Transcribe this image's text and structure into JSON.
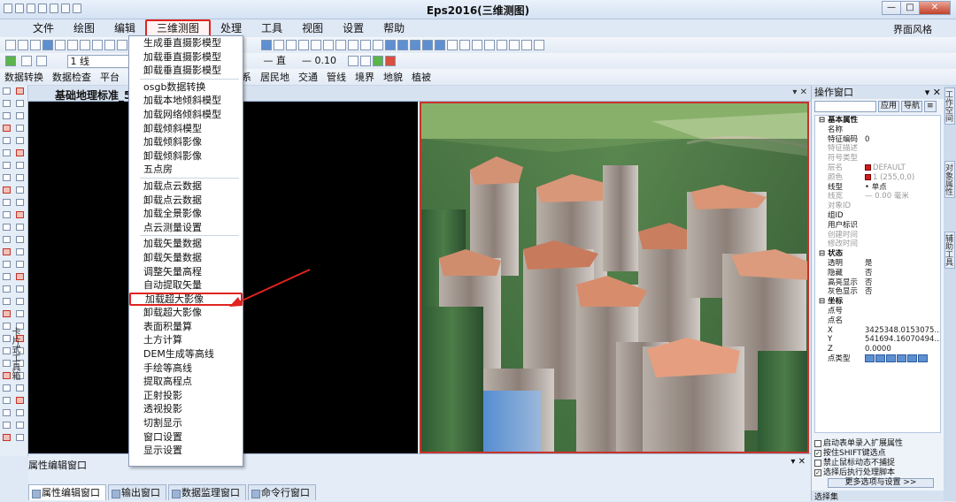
{
  "app": {
    "title": "Eps2016(三维测图)",
    "ui_style_label": "界面风格",
    "window_buttons": [
      "—",
      "□",
      "✕"
    ]
  },
  "menu": [
    {
      "label": "文件"
    },
    {
      "label": "绘图"
    },
    {
      "label": "编辑"
    },
    {
      "label": "三维测图",
      "active": true
    },
    {
      "label": "处理"
    },
    {
      "label": "工具"
    },
    {
      "label": "视图"
    },
    {
      "label": "设置"
    },
    {
      "label": "帮助"
    }
  ],
  "toolbar": {
    "layer_combo": "1 线",
    "line_width": "0.10",
    "straight_label": "直"
  },
  "categories": [
    "数据转换",
    "数据检查",
    "平台",
    "系",
    "居民地",
    "交通",
    "管线",
    "境界",
    "地貌",
    "植被"
  ],
  "dropdown": {
    "groups": [
      [
        "生成垂直摄影模型",
        "加载垂直摄影模型",
        "卸载垂直摄影模型"
      ],
      [
        "osgb数据转换",
        "加载本地倾斜模型",
        "加载网络倾斜模型",
        "卸载倾斜模型",
        "加载倾斜影像",
        "卸载倾斜影像",
        "五点房"
      ],
      [
        "加载点云数据",
        "卸载点云数据",
        "加载全景影像",
        "点云测量设置"
      ],
      [
        "加载矢量数据",
        "卸载矢量数据",
        "调整矢量高程",
        "自动提取矢量",
        "加载超大影像",
        "卸载超大影像",
        "表面积量算",
        "土方计算",
        "DEM生成等高线",
        "手绘等高线",
        "提取高程点",
        "正射投影",
        "透视投影",
        "切割显示",
        "窗口设置",
        "显示设置"
      ]
    ],
    "highlighted": "加载超大影像"
  },
  "document": {
    "tab_label": "基础地理标准_5",
    "pin": "▾ ✕"
  },
  "bottom_panel": {
    "title": "属性编辑窗口",
    "tabs": [
      {
        "label": "属性编辑窗口",
        "active": true
      },
      {
        "label": "输出窗口"
      },
      {
        "label": "数据监理窗口"
      },
      {
        "label": "命令行窗口"
      }
    ]
  },
  "left_tools_label": "卡片式工具箱",
  "right_panel": {
    "title": "操作窗口",
    "btn_apply": "应用",
    "btn_nav": "导航",
    "sections": {
      "basic": "基本属性",
      "state": "状态",
      "coords": "坐标"
    },
    "basic_rows": [
      {
        "k": "名称",
        "v": ""
      },
      {
        "k": "特征编码",
        "v": "0"
      },
      {
        "k": "特征描述",
        "v": "",
        "grey": true
      },
      {
        "k": "符号类型",
        "v": "",
        "grey": true
      },
      {
        "k": "层名",
        "v": "DEFAULT",
        "grey": true,
        "swatch": true
      },
      {
        "k": "颜色",
        "v": "1 (255,0,0)",
        "grey": true,
        "swatch": true
      },
      {
        "k": "线型",
        "v": "• 单点"
      },
      {
        "k": "线宽",
        "v": "— 0.00 毫米",
        "grey": true
      },
      {
        "k": "对象ID",
        "v": "",
        "grey": true
      },
      {
        "k": "组ID",
        "v": ""
      },
      {
        "k": "用户标识",
        "v": ""
      },
      {
        "k": "创建时间",
        "v": "",
        "grey": true
      },
      {
        "k": "修改时间",
        "v": "",
        "grey": true
      }
    ],
    "state_rows": [
      {
        "k": "透明",
        "v": "是"
      },
      {
        "k": "隐藏",
        "v": "否"
      },
      {
        "k": "高亮显示",
        "v": "否"
      },
      {
        "k": "灰色显示",
        "v": "否"
      }
    ],
    "coord_rows": [
      {
        "k": "点号",
        "v": ""
      },
      {
        "k": "点名",
        "v": ""
      },
      {
        "k": "X",
        "v": "3425348.0153075..."
      },
      {
        "k": "Y",
        "v": "541694.16070494..."
      },
      {
        "k": "Z",
        "v": "0.0000"
      },
      {
        "k": "点类型",
        "v": ""
      }
    ],
    "checks": [
      {
        "label": "启动表单录入扩展属性",
        "checked": false
      },
      {
        "label": "按住SHIFT键选点",
        "checked": true
      },
      {
        "label": "禁止鼠标动态不捕捉",
        "checked": false
      },
      {
        "label": "选择后执行处理脚本",
        "checked": true
      }
    ],
    "more_button": "更多选项与设置 >>",
    "footer_tab": "选择集"
  },
  "side_tabs": [
    "工作空间",
    "对象属性",
    "辅助工具"
  ]
}
